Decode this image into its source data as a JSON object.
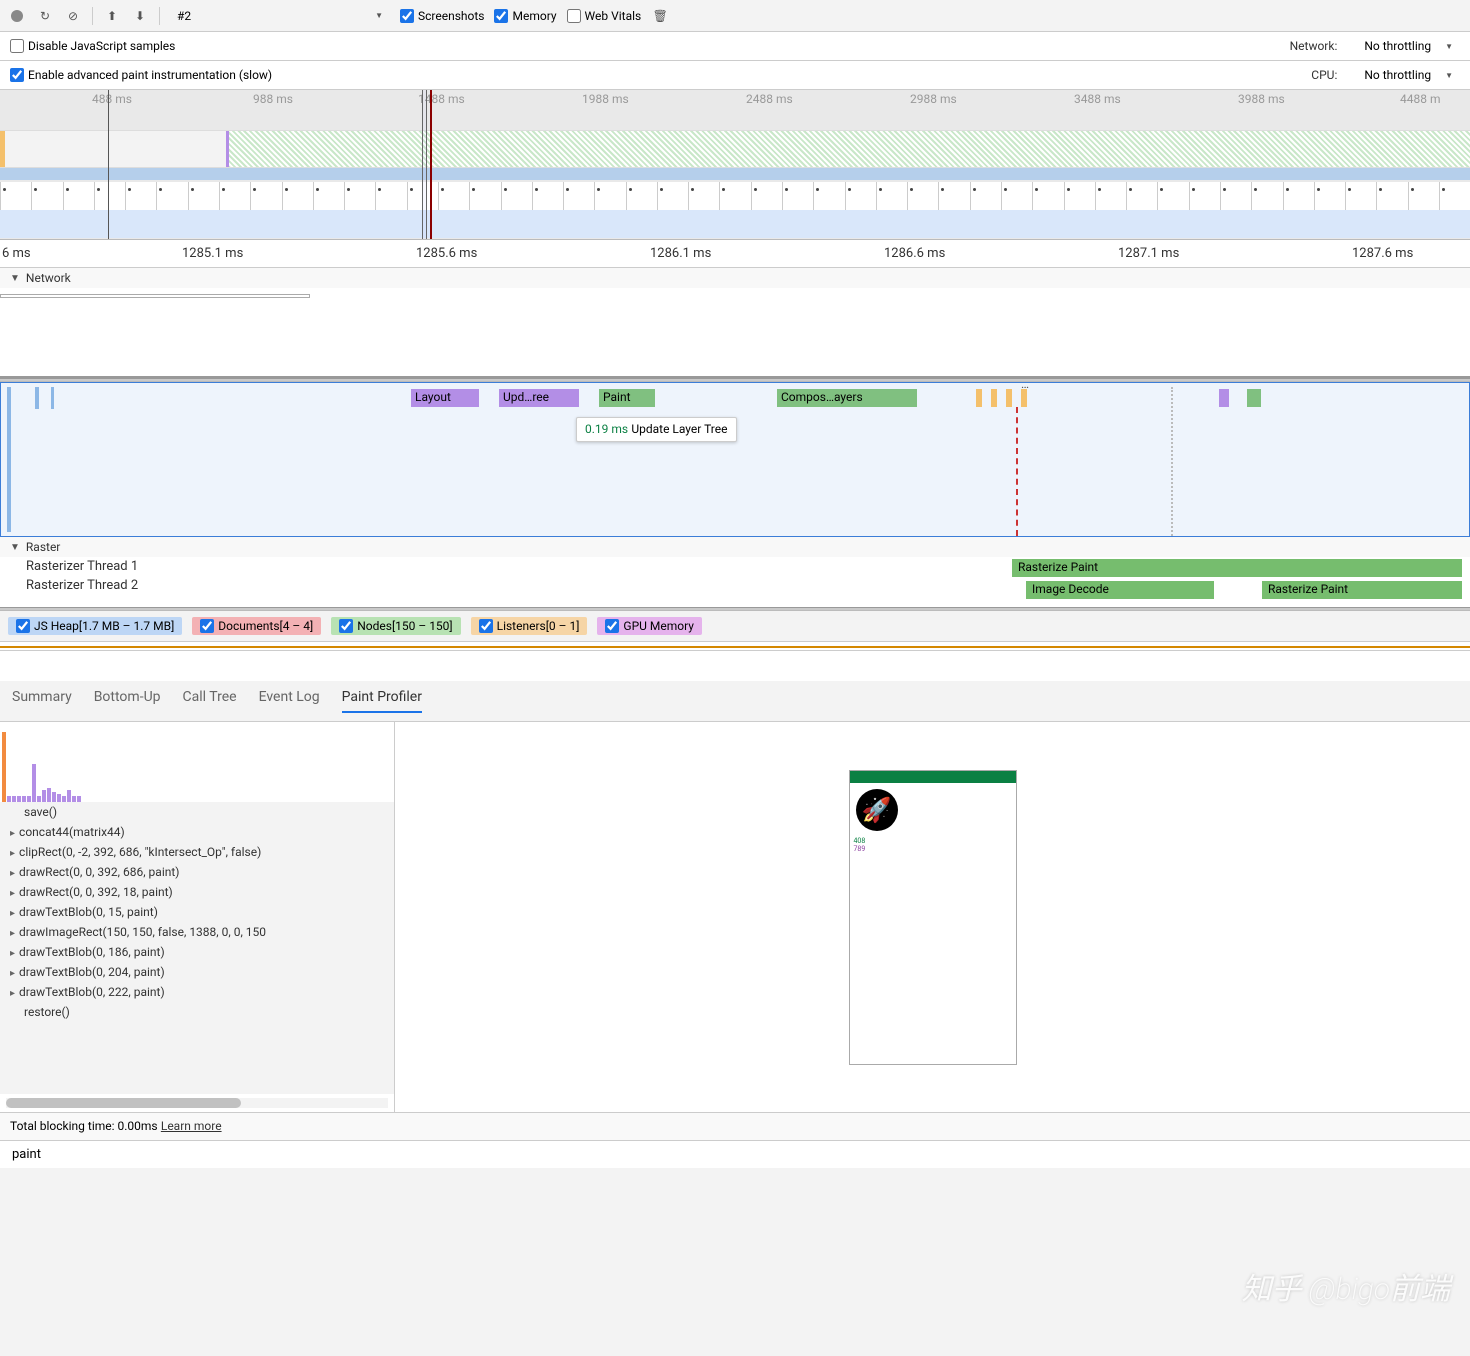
{
  "toolbar": {
    "recording_label": "#2",
    "screenshots": "Screenshots",
    "memory": "Memory",
    "webvitals": "Web Vitals"
  },
  "settings": {
    "disable_js": "Disable JavaScript samples",
    "adv_paint": "Enable advanced paint instrumentation (slow)",
    "network_label": "Network:",
    "network_value": "No throttling",
    "cpu_label": "CPU:",
    "cpu_value": "No throttling"
  },
  "overview": {
    "ticks": [
      "488 ms",
      "988 ms",
      "1488 ms",
      "1988 ms",
      "2488 ms",
      "2988 ms",
      "3488 ms",
      "3988 ms",
      "4488 m"
    ]
  },
  "ruler": {
    "ticks": [
      "6 ms",
      "1285.1 ms",
      "1285.6 ms",
      "1286.1 ms",
      "1286.6 ms",
      "1287.1 ms",
      "1287.6 ms"
    ]
  },
  "sections": {
    "network": "Network",
    "raster": "Raster"
  },
  "flame": {
    "layout": "Layout",
    "update_tree": "Upd…ree",
    "paint": "Paint",
    "composite": "Compos…ayers",
    "tooltip_dur": "0.19 ms",
    "tooltip_label": "Update Layer Tree"
  },
  "raster": {
    "thread1": "Rasterizer Thread 1",
    "thread2": "Rasterizer Thread 2",
    "rasterize_paint": "Rasterize Paint",
    "image_decode": "Image Decode"
  },
  "legend": {
    "js": "JS Heap[1.7 MB – 1.7 MB]",
    "docs": "Documents[4 – 4]",
    "nodes": "Nodes[150 – 150]",
    "listeners": "Listeners[0 – 1]",
    "gpu": "GPU Memory"
  },
  "tabs": {
    "summary": "Summary",
    "bottomup": "Bottom-Up",
    "calltree": "Call Tree",
    "eventlog": "Event Log",
    "paintprofiler": "Paint Profiler"
  },
  "cmds": [
    "save()",
    "concat44(matrix44)",
    "clipRect(0, -2, 392, 686, \"kIntersect_Op\", false)",
    "drawRect(0, 0, 392, 686, paint)",
    "drawRect(0, 0, 392, 18, paint)",
    "drawTextBlob(0, 15, paint)",
    "drawImageRect(150, 150, false, 1388, 0, 0, 150",
    "drawTextBlob(0, 186, paint)",
    "drawTextBlob(0, 204, paint)",
    "drawTextBlob(0, 222, paint)",
    "restore()"
  ],
  "status": {
    "blocking": "Total blocking time: 0.00ms",
    "learn": "Learn more"
  },
  "search": {
    "value": "paint"
  },
  "watermark": "知乎 @bigo前端",
  "preview": {
    "tiny1": "408",
    "tiny2": "789"
  }
}
